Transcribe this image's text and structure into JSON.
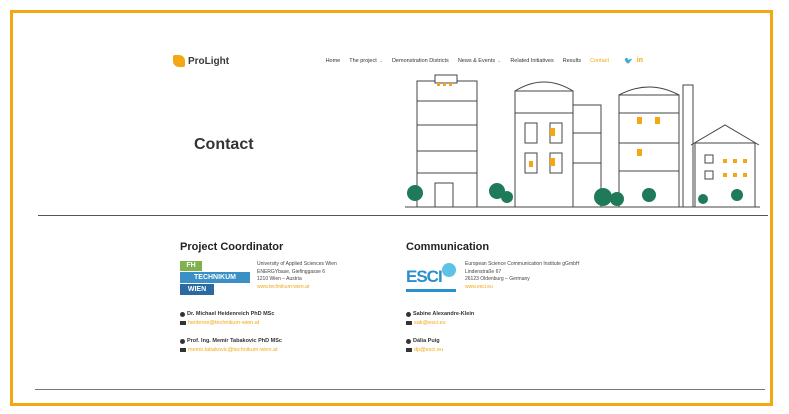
{
  "brand": {
    "name": "ProLight",
    "accent": "#f3a712"
  },
  "nav": {
    "items": [
      {
        "label": "Home",
        "dropdown": false,
        "active": false
      },
      {
        "label": "The project",
        "dropdown": true,
        "active": false
      },
      {
        "label": "Demonstration Districts",
        "dropdown": false,
        "active": false
      },
      {
        "label": "News & Events",
        "dropdown": true,
        "active": false
      },
      {
        "label": "Related Initiatives",
        "dropdown": false,
        "active": false
      },
      {
        "label": "Results",
        "dropdown": false,
        "active": false
      },
      {
        "label": "Contact",
        "dropdown": false,
        "active": true
      }
    ],
    "social": {
      "twitter": "twitter-icon",
      "linkedin": "linkedin-icon"
    }
  },
  "hero": {
    "title": "Contact"
  },
  "coordinator": {
    "heading": "Project Coordinator",
    "org_logo_lines": [
      "FH",
      "TECHNIKUM",
      "WIEN"
    ],
    "org_lines": [
      "University of Applied Sciences Wien",
      "ENERGYbase, Giefinggasse 6",
      "1210 Wien – Austria"
    ],
    "org_url": "www.technikum-wien.at",
    "people": [
      {
        "name": "Dr. Michael Heidenreich PhD MSc",
        "email": "heidenre@technikum-wien.at"
      },
      {
        "name": "Prof. Ing. Memir Tabakovic PhD MSc",
        "email": "memir.tabakovic@technikum-wien.at"
      }
    ]
  },
  "communication": {
    "heading": "Communication",
    "org_logo": "ESCI",
    "org_lines": [
      "European Science Communication Institute gGmbH",
      "Lindenstraße 67",
      "26123 Oldenburg – Germany"
    ],
    "org_url": "www.esci.eu",
    "people": [
      {
        "name": "Sabine Alexandre-Klein",
        "email": "sak@esci.eu"
      },
      {
        "name": "Dália Puig",
        "email": "dp@esci.eu"
      }
    ]
  }
}
